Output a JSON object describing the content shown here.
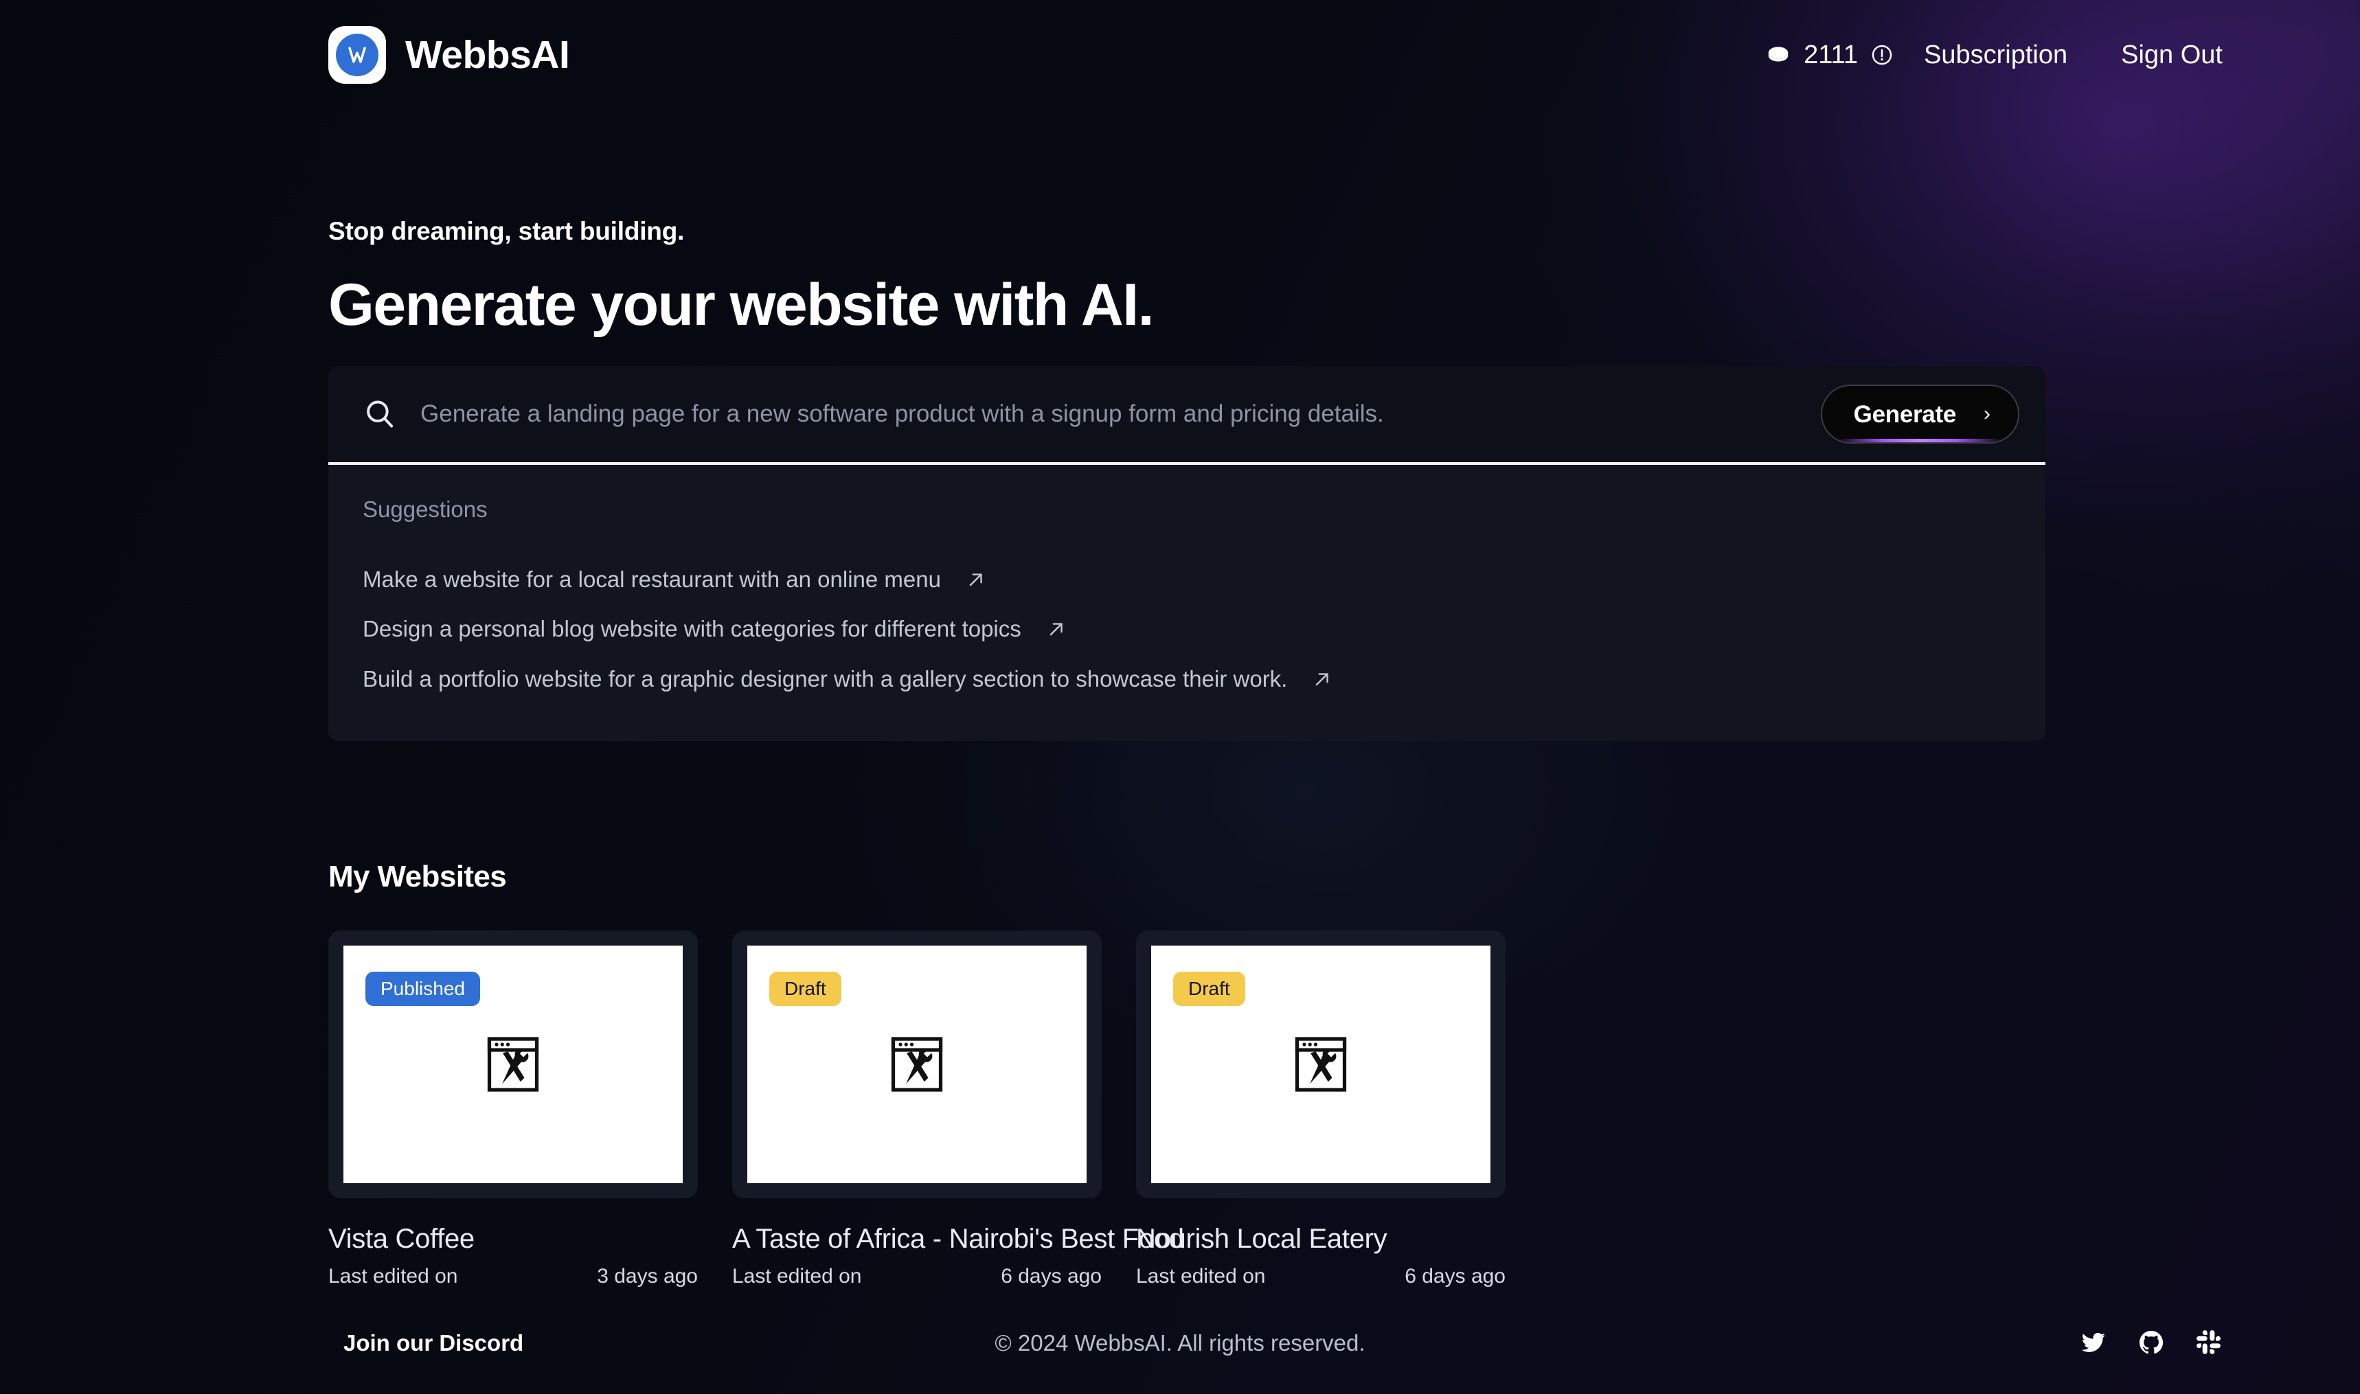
{
  "brand": {
    "name": "WebbsAI",
    "logo_icon": "webbsai-logo-icon",
    "logo_bg": "#ffffff",
    "logo_disc_color": "#2f6fd6"
  },
  "header": {
    "credits": {
      "coin_icon": "coin-icon",
      "count": "2111",
      "info_icon": "info-circle-icon"
    },
    "subscription_label": "Subscription",
    "sign_out_label": "Sign Out"
  },
  "hero": {
    "eyebrow": "Stop dreaming, start building.",
    "headline": "Generate your website with AI."
  },
  "search": {
    "icon": "search-icon",
    "value": "",
    "placeholder": "Generate a landing page for a new software product with a signup form and pricing details.",
    "generate_label": "Generate",
    "generate_chevron": "›",
    "accent_color": "#a855f7"
  },
  "suggestions": {
    "title": "Suggestions",
    "items": [
      {
        "text": "Make a website for a local restaurant with an online menu",
        "icon": "arrow-up-right-icon"
      },
      {
        "text": "Design a personal blog website with categories for different topics",
        "icon": "arrow-up-right-icon"
      },
      {
        "text": "Build a portfolio website for a graphic designer with a gallery section to showcase their work.",
        "icon": "arrow-up-right-icon"
      }
    ]
  },
  "websites": {
    "section_title": "My Websites",
    "meta_label": "Last edited on",
    "cards": [
      {
        "title": "Vista Coffee",
        "status": "Published",
        "status_color": "#2f6fd6",
        "edited_label": "Last edited on",
        "edited_value": "3 days ago",
        "thumb_icon": "broken-image-icon"
      },
      {
        "title": "A Taste of Africa - Nairobi's Best Food",
        "status": "Draft",
        "status_color": "#f5ca4c",
        "edited_label": "Last edited on",
        "edited_value": "6 days ago",
        "thumb_icon": "broken-image-icon"
      },
      {
        "title": "Nourish Local Eatery",
        "status": "Draft",
        "status_color": "#f5ca4c",
        "edited_label": "Last edited on",
        "edited_value": "6 days ago",
        "thumb_icon": "broken-image-icon"
      }
    ]
  },
  "footer": {
    "discord_label": "Join our Discord",
    "copyright": "© 2024 WebbsAI. All rights reserved.",
    "socials": [
      "twitter-icon",
      "github-icon",
      "slack-icon"
    ]
  }
}
